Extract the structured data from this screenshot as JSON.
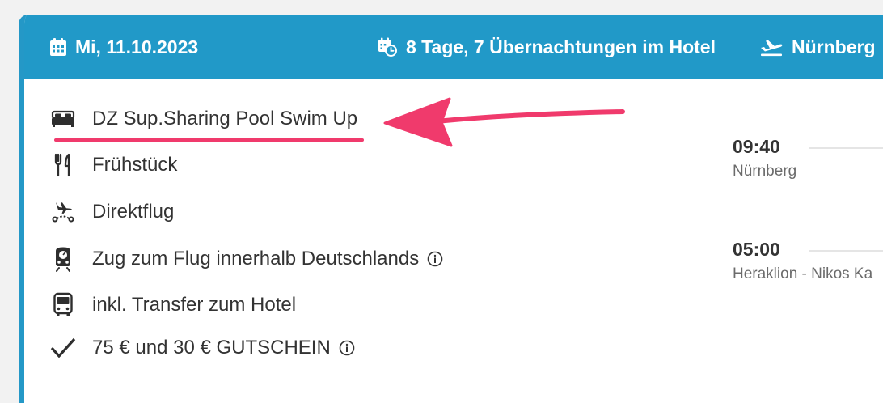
{
  "header": {
    "date": "Mi, 11.10.2023",
    "duration": "8 Tage, 7 Übernachtungen im Hotel",
    "departure_airport": "Nürnberg",
    "icons": [
      "calendar-icon",
      "calendar-clock-icon",
      "plane-departure-icon"
    ],
    "background_color": "#2199c8"
  },
  "features": [
    {
      "icon": "bed-icon",
      "label": "DZ Sup.Sharing Pool Swim Up"
    },
    {
      "icon": "cutlery-icon",
      "label": "Frühstück"
    },
    {
      "icon": "direct-flight-icon",
      "label": "Direktflug"
    },
    {
      "icon": "train-icon",
      "label": "Zug zum Flug innerhalb Deutschlands",
      "info": true
    },
    {
      "icon": "bus-icon",
      "label": "inkl. Transfer zum Hotel"
    },
    {
      "icon": "checkmark-icon",
      "label": "75 € und 30 € GUTSCHEIN",
      "info": true
    }
  ],
  "flights": [
    {
      "time": "09:40",
      "place": "Nürnberg"
    },
    {
      "time": "05:00",
      "place": "Heraklion - Nikos Ka"
    }
  ],
  "annotation": {
    "highlight_color": "#f03a6c",
    "highlighted_feature": "DZ Sup.Sharing Pool Swim Up"
  }
}
